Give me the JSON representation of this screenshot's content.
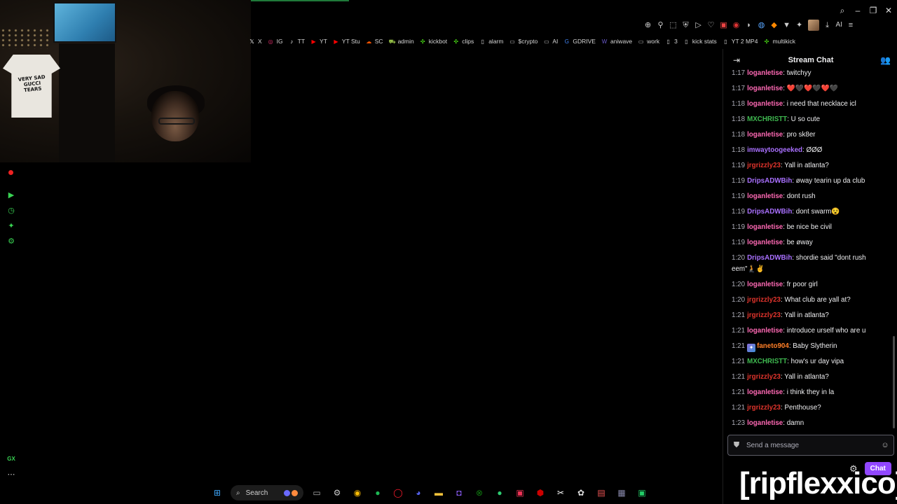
{
  "bookmarks": [
    {
      "label": "X",
      "icon": "x-logo-icon",
      "color": "#ffffff"
    },
    {
      "label": "IG",
      "icon": "instagram-icon",
      "color": "#e1306c"
    },
    {
      "label": "TT",
      "icon": "tiktok-icon",
      "color": "#ffffff"
    },
    {
      "label": "YT",
      "icon": "youtube-icon",
      "color": "#ff0000"
    },
    {
      "label": "YT Stu",
      "icon": "youtube-studio-icon",
      "color": "#ff0000"
    },
    {
      "label": "SC",
      "icon": "soundcloud-icon",
      "color": "#ff5500"
    },
    {
      "label": "admin",
      "icon": "shopify-icon",
      "color": "#95bf47"
    },
    {
      "label": "kickbot",
      "icon": "kick-icon",
      "color": "#53fc18"
    },
    {
      "label": "clips",
      "icon": "kick-icon",
      "color": "#53fc18"
    },
    {
      "label": "alarm",
      "icon": "page-icon",
      "color": "#cccccc"
    },
    {
      "label": "$crypto",
      "icon": "folder-icon",
      "color": "#cccccc"
    },
    {
      "label": "AI",
      "icon": "folder-icon",
      "color": "#cccccc"
    },
    {
      "label": "GDRIVE",
      "icon": "google-icon",
      "color": "#4285f4"
    },
    {
      "label": "aniwave",
      "icon": "aniwave-icon",
      "color": "#6a5acd"
    },
    {
      "label": "work",
      "icon": "folder-icon",
      "color": "#cccccc"
    },
    {
      "label": "3",
      "icon": "page-icon",
      "color": "#cccccc"
    },
    {
      "label": "kick stats",
      "icon": "page-icon",
      "color": "#cccccc"
    },
    {
      "label": "YT 2 MP4",
      "icon": "page-icon",
      "color": "#cccccc"
    },
    {
      "label": "multikick",
      "icon": "kick-icon",
      "color": "#53fc18"
    }
  ],
  "toolbar": {
    "ai_label": "AI"
  },
  "chat": {
    "title": "Stream Chat",
    "input_placeholder": "Send a message",
    "chat_button": "Chat",
    "messages": [
      {
        "ts": "1:17",
        "user": "loganletise",
        "color": "#ff69b4",
        "text": ": twitchyy"
      },
      {
        "ts": "1:17",
        "user": "loganletise",
        "color": "#ff69b4",
        "text": ": ❤️🖤❤️🖤❤️🖤"
      },
      {
        "ts": "1:18",
        "user": "loganletise",
        "color": "#ff69b4",
        "text": ": i need that necklace icl"
      },
      {
        "ts": "1:18",
        "user": "MXCHRISTT",
        "color": "#3fb950",
        "text": ": U so cute"
      },
      {
        "ts": "1:18",
        "user": "loganletise",
        "color": "#ff69b4",
        "text": ": pro sk8er"
      },
      {
        "ts": "1:18",
        "user": "imwaytoogeeked",
        "color": "#a970ff",
        "text": ": ØØØ"
      },
      {
        "ts": "1:19",
        "user": "jrgrizzly23",
        "color": "#e0342c",
        "text": ": Yall in atlanta?"
      },
      {
        "ts": "1:19",
        "user": "DripsADWBih",
        "color": "#a970ff",
        "text": ": øway tearin up da club"
      },
      {
        "ts": "1:19",
        "user": "loganletise",
        "color": "#ff69b4",
        "text": ": dont rush"
      },
      {
        "ts": "1:19",
        "user": "DripsADWBih",
        "color": "#a970ff",
        "text": ": dont swarm😵"
      },
      {
        "ts": "1:19",
        "user": "loganletise",
        "color": "#ff69b4",
        "text": ": be nice be civil"
      },
      {
        "ts": "1:19",
        "user": "loganletise",
        "color": "#ff69b4",
        "text": ": be øway"
      },
      {
        "ts": "1:20",
        "user": "DripsADWBih",
        "color": "#a970ff",
        "text": ": shordie said \"dont rush eem\"🧎✌️"
      },
      {
        "ts": "1:20",
        "user": "loganletise",
        "color": "#ff69b4",
        "text": ": fr poor girl"
      },
      {
        "ts": "1:20",
        "user": "jrgrizzly23",
        "color": "#e0342c",
        "text": ": What club are yall at?"
      },
      {
        "ts": "1:21",
        "user": "jrgrizzly23",
        "color": "#e0342c",
        "text": ": Yall in atlanta?"
      },
      {
        "ts": "1:21",
        "user": "loganletise",
        "color": "#ff69b4",
        "text": ": introduce urself who are u"
      },
      {
        "ts": "1:21",
        "user": "faneto904",
        "color": "#ff7f27",
        "text": ": Baby Slytherin",
        "badge": true
      },
      {
        "ts": "1:21",
        "user": "MXCHRISTT",
        "color": "#3fb950",
        "text": ": how's ur day vipa"
      },
      {
        "ts": "1:21",
        "user": "jrgrizzly23",
        "color": "#e0342c",
        "text": ": Yall in atlanta?"
      },
      {
        "ts": "1:21",
        "user": "loganletise",
        "color": "#ff69b4",
        "text": ": i think they in la"
      },
      {
        "ts": "1:21",
        "user": "jrgrizzly23",
        "color": "#e0342c",
        "text": ": Penthouse?"
      },
      {
        "ts": "1:23",
        "user": "loganletise",
        "color": "#ff69b4",
        "text": ": damn"
      }
    ]
  },
  "taskbar": {
    "search_label": "Search"
  },
  "webcam": {
    "shirt_text": "VERY SAD GUCCI TEARS"
  },
  "left_rail": {
    "bottom_label": "GX"
  },
  "overlay": {
    "name": "[ripflexxico]"
  }
}
